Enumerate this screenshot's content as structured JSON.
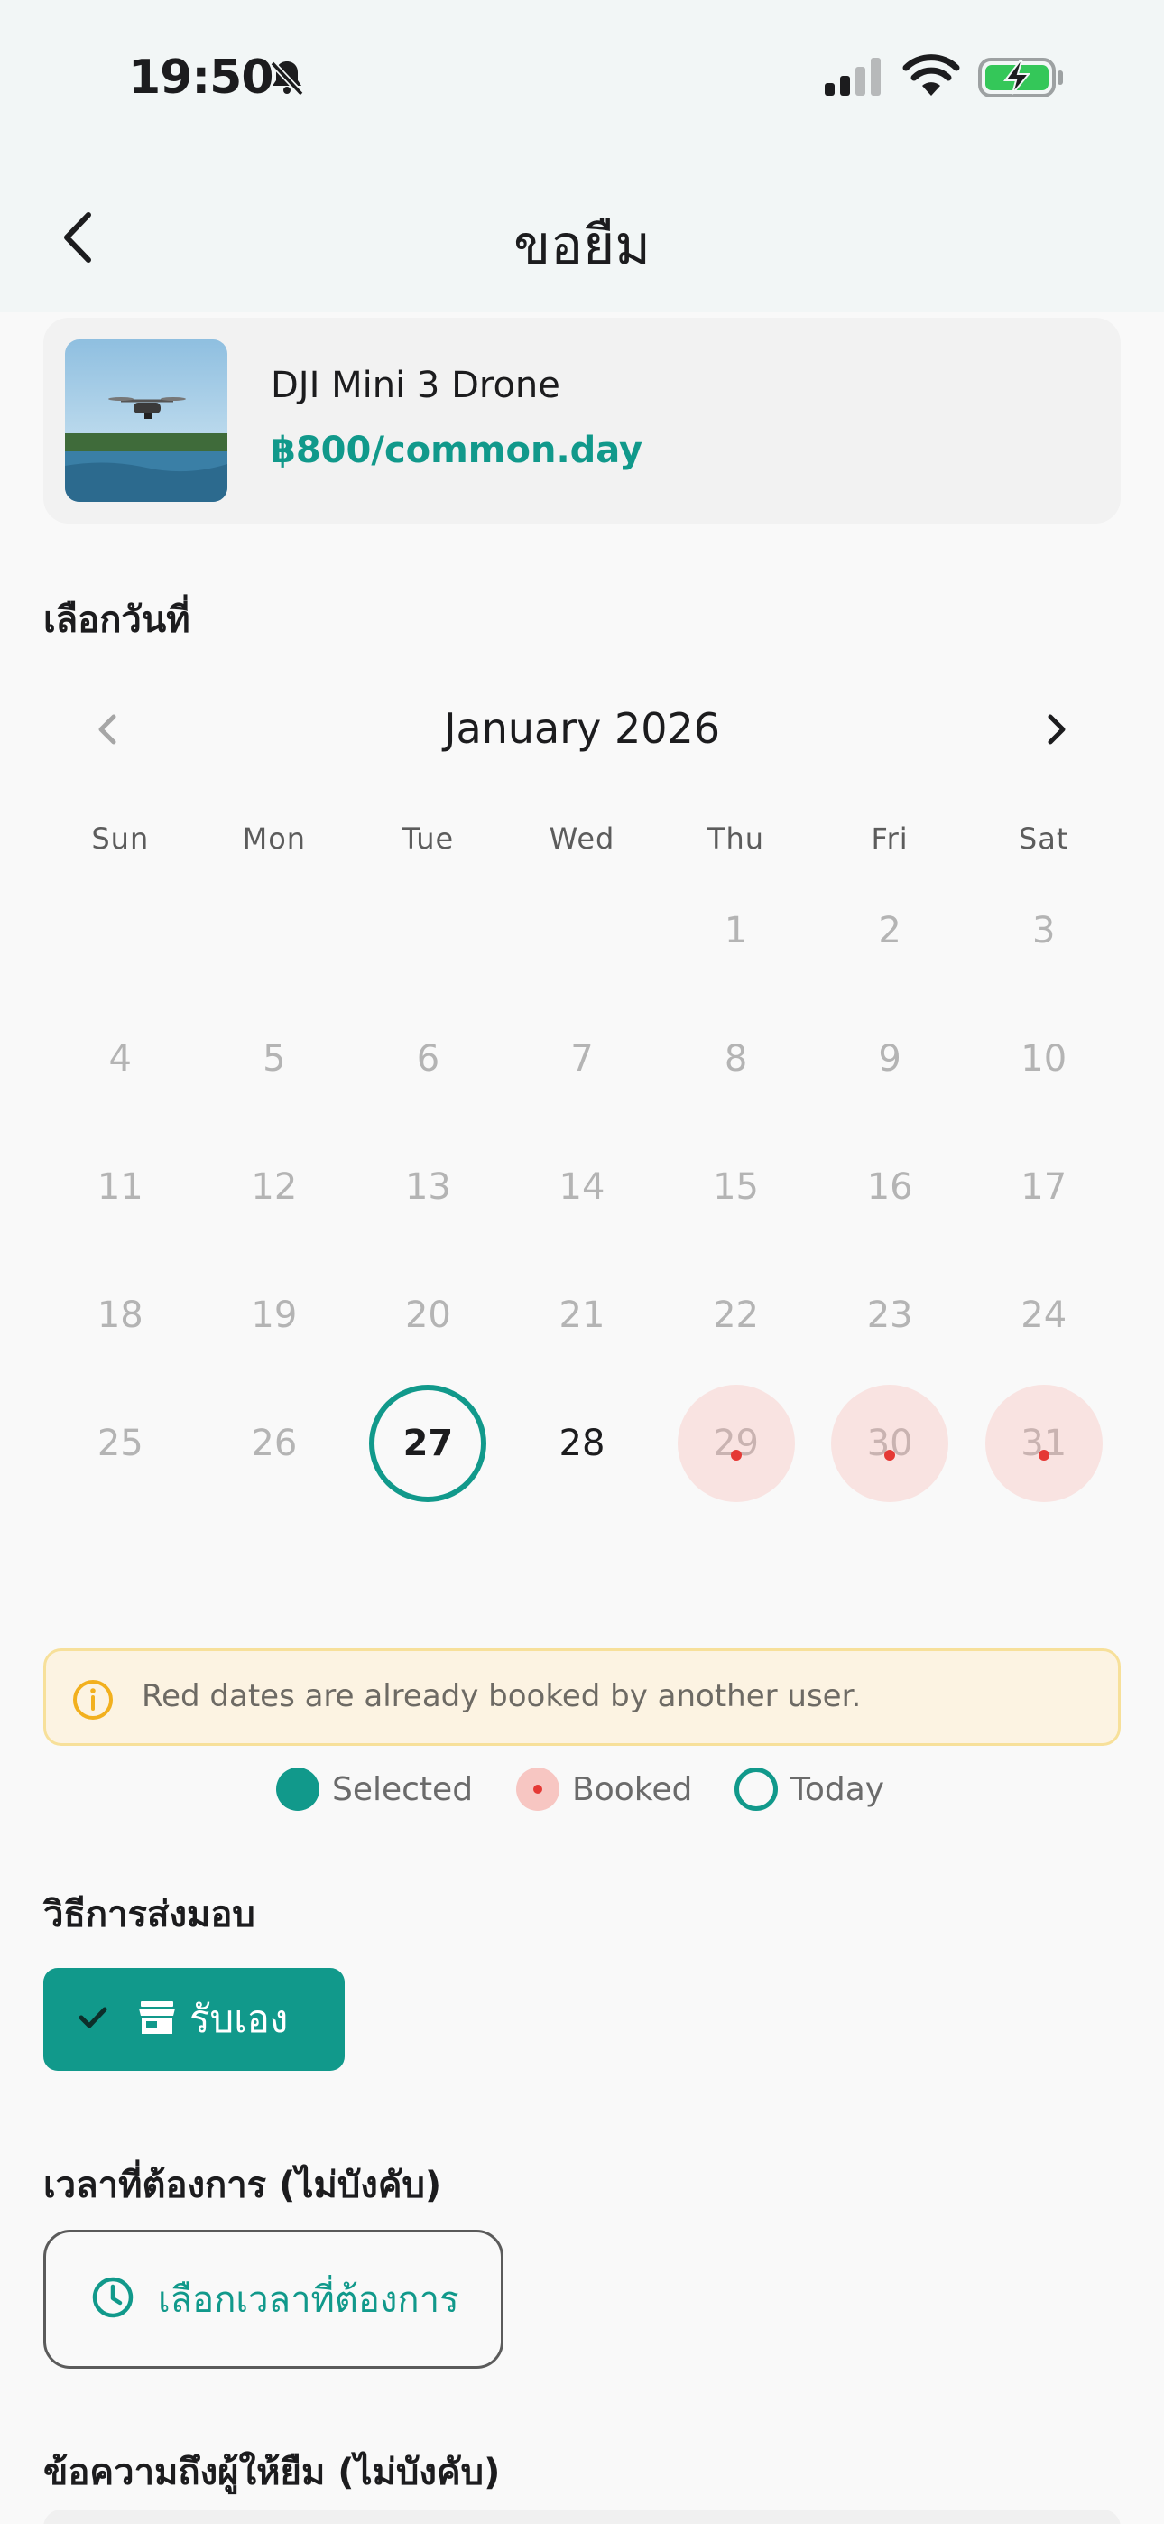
{
  "status_bar": {
    "time": "19:50"
  },
  "nav": {
    "title": "ขอยืม"
  },
  "item": {
    "name": "DJI Mini 3 Drone",
    "price": "฿800/common.day"
  },
  "date_section": {
    "label": "เลือกวันที่"
  },
  "calendar": {
    "month_label": "January 2026",
    "weekdays": [
      "Sun",
      "Mon",
      "Tue",
      "Wed",
      "Thu",
      "Fri",
      "Sat"
    ],
    "days": [
      {
        "day": "1",
        "state": "past"
      },
      {
        "day": "2",
        "state": "past"
      },
      {
        "day": "3",
        "state": "past"
      },
      {
        "day": "4",
        "state": "past"
      },
      {
        "day": "5",
        "state": "past"
      },
      {
        "day": "6",
        "state": "past"
      },
      {
        "day": "7",
        "state": "past"
      },
      {
        "day": "8",
        "state": "past"
      },
      {
        "day": "9",
        "state": "past"
      },
      {
        "day": "10",
        "state": "past"
      },
      {
        "day": "11",
        "state": "past"
      },
      {
        "day": "12",
        "state": "past"
      },
      {
        "day": "13",
        "state": "past"
      },
      {
        "day": "14",
        "state": "past"
      },
      {
        "day": "15",
        "state": "past"
      },
      {
        "day": "16",
        "state": "past"
      },
      {
        "day": "17",
        "state": "past"
      },
      {
        "day": "18",
        "state": "past"
      },
      {
        "day": "19",
        "state": "past"
      },
      {
        "day": "20",
        "state": "past"
      },
      {
        "day": "21",
        "state": "past"
      },
      {
        "day": "22",
        "state": "past"
      },
      {
        "day": "23",
        "state": "past"
      },
      {
        "day": "24",
        "state": "past"
      },
      {
        "day": "25",
        "state": "past"
      },
      {
        "day": "26",
        "state": "past"
      },
      {
        "day": "27",
        "state": "today"
      },
      {
        "day": "28",
        "state": "available"
      },
      {
        "day": "29",
        "state": "booked"
      },
      {
        "day": "30",
        "state": "booked"
      },
      {
        "day": "31",
        "state": "booked"
      }
    ]
  },
  "notice": {
    "text": "Red dates are already booked by another user."
  },
  "legend": {
    "selected": "Selected",
    "booked": "Booked",
    "today": "Today"
  },
  "delivery": {
    "label": "วิธีการส่งมอบ",
    "option": "รับเอง"
  },
  "time": {
    "label": "เวลาที่ต้องการ (ไม่บังคับ)",
    "button": "เลือกเวลาที่ต้องการ"
  },
  "message": {
    "label": "ข้อความถึงผู้ให้ยืม (ไม่บังคับ)"
  },
  "colors": {
    "accent": "#11998b",
    "booked_bg": "#f9e3e1",
    "booked_dot": "#e53935",
    "notice_bg": "#fcf3e2"
  }
}
